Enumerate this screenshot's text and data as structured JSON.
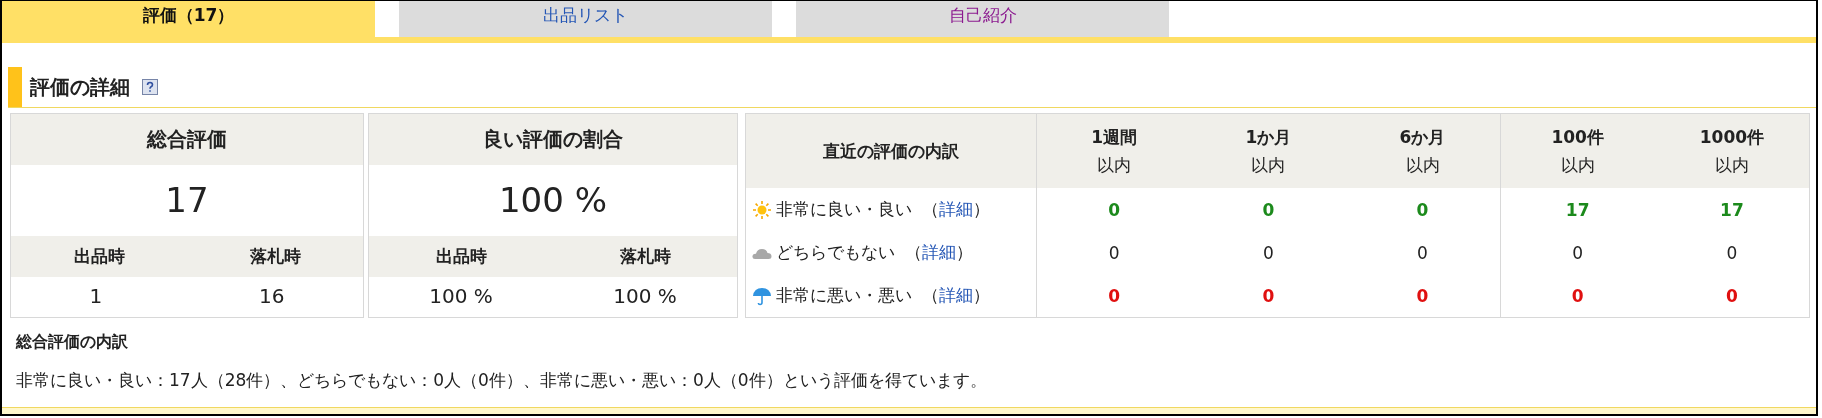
{
  "tabs": [
    {
      "label": "評価（17）",
      "selected": true,
      "visited": false
    },
    {
      "label": "出品リスト",
      "selected": false,
      "visited": false
    },
    {
      "label": "自己紹介",
      "selected": false,
      "visited": true
    }
  ],
  "section_title": "評価の詳細",
  "total_card": {
    "title": "総合評価",
    "value": "17",
    "columns": [
      {
        "label": "出品時",
        "value": "1"
      },
      {
        "label": "落札時",
        "value": "16"
      }
    ]
  },
  "ratio_card": {
    "title": "良い評価の割合",
    "value": "100 %",
    "columns": [
      {
        "label": "出品時",
        "value": "100 %"
      },
      {
        "label": "落札時",
        "value": "100 %"
      }
    ]
  },
  "breakdown": {
    "title": "直近の評価の内訳",
    "periods": [
      {
        "line1": "1週間",
        "line2": "以内",
        "separated": false
      },
      {
        "line1": "1か月",
        "line2": "以内",
        "separated": false
      },
      {
        "line1": "6か月",
        "line2": "以内",
        "separated": false
      },
      {
        "line1": "100件",
        "line2": "以内",
        "separated": true
      },
      {
        "line1": "1000件",
        "line2": "以内",
        "separated": false
      }
    ],
    "rows": [
      {
        "kind": "good",
        "label": "非常に良い・良い",
        "open": "（",
        "link": "詳細",
        "close": "）",
        "values": [
          "0",
          "0",
          "0",
          "17",
          "17"
        ]
      },
      {
        "kind": "neutral",
        "label": "どちらでもない",
        "open": "（",
        "link": "詳細",
        "close": "）",
        "values": [
          "0",
          "0",
          "0",
          "0",
          "0"
        ]
      },
      {
        "kind": "bad",
        "label": "非常に悪い・悪い",
        "open": "（",
        "link": "詳細",
        "close": "）",
        "values": [
          "0",
          "0",
          "0",
          "0",
          "0"
        ]
      }
    ]
  },
  "summary": {
    "title": "総合評価の内訳",
    "text": "非常に良い・良い：17人（28件）、どちらでもない：0人（0件）、非常に悪い・悪い：0人（0件）という評価を得ています。"
  }
}
